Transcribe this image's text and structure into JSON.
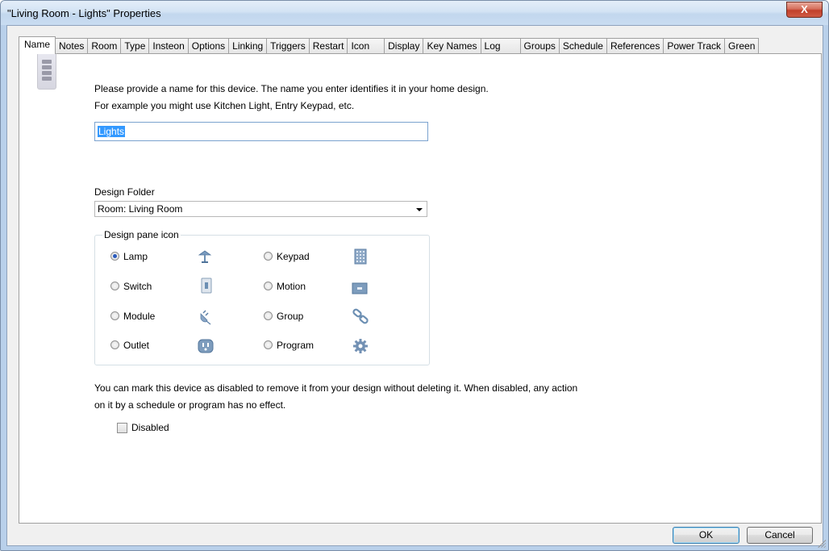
{
  "window": {
    "title": "\"Living Room - Lights\" Properties",
    "close_label": "X"
  },
  "tabs": [
    {
      "label": "Name",
      "active": true
    },
    {
      "label": "Notes"
    },
    {
      "label": "Room"
    },
    {
      "label": "Type"
    },
    {
      "label": "Insteon"
    },
    {
      "label": "Options"
    },
    {
      "label": "Linking"
    },
    {
      "label": "Triggers"
    },
    {
      "label": "Restart"
    },
    {
      "label": "Icon"
    },
    {
      "label": "Display"
    },
    {
      "label": "Key Names"
    },
    {
      "label": "Log"
    },
    {
      "label": "Groups"
    },
    {
      "label": "Schedule"
    },
    {
      "label": "References"
    },
    {
      "label": "Power Track"
    },
    {
      "label": "Green"
    }
  ],
  "name_panel": {
    "instruction_line1": "Please provide a name for this device.  The name you enter identifies it in your home design.",
    "instruction_line2": "For example you might use Kitchen Light, Entry Keypad, etc.",
    "name_value": "Lights",
    "design_folder_label": "Design Folder",
    "design_folder_value": "Room: Living Room",
    "design_pane_icon_label": "Design pane icon",
    "icon_options": [
      {
        "label": "Lamp",
        "icon": "lamp-icon",
        "checked": true
      },
      {
        "label": "Switch",
        "icon": "switch-icon",
        "checked": false
      },
      {
        "label": "Module",
        "icon": "plug-icon",
        "checked": false
      },
      {
        "label": "Outlet",
        "icon": "outlet-icon",
        "checked": false
      },
      {
        "label": "Keypad",
        "icon": "keypad-icon",
        "checked": false
      },
      {
        "label": "Motion",
        "icon": "motion-icon",
        "checked": false
      },
      {
        "label": "Group",
        "icon": "chain-link-icon",
        "checked": false
      },
      {
        "label": "Program",
        "icon": "gear-icon",
        "checked": false
      }
    ],
    "disabled_note_line1": "You can mark this device as disabled to remove it from your design without deleting it.  When disabled, any action",
    "disabled_note_line2": "on it by a schedule or program has no effect.",
    "disabled_label": "Disabled",
    "disabled_checked": false
  },
  "footer": {
    "ok_label": "OK",
    "cancel_label": "Cancel"
  },
  "colors": {
    "selection": "#3399ff",
    "icon_blue": "#6c8fb3",
    "titlebar": "#c9dcf0"
  }
}
